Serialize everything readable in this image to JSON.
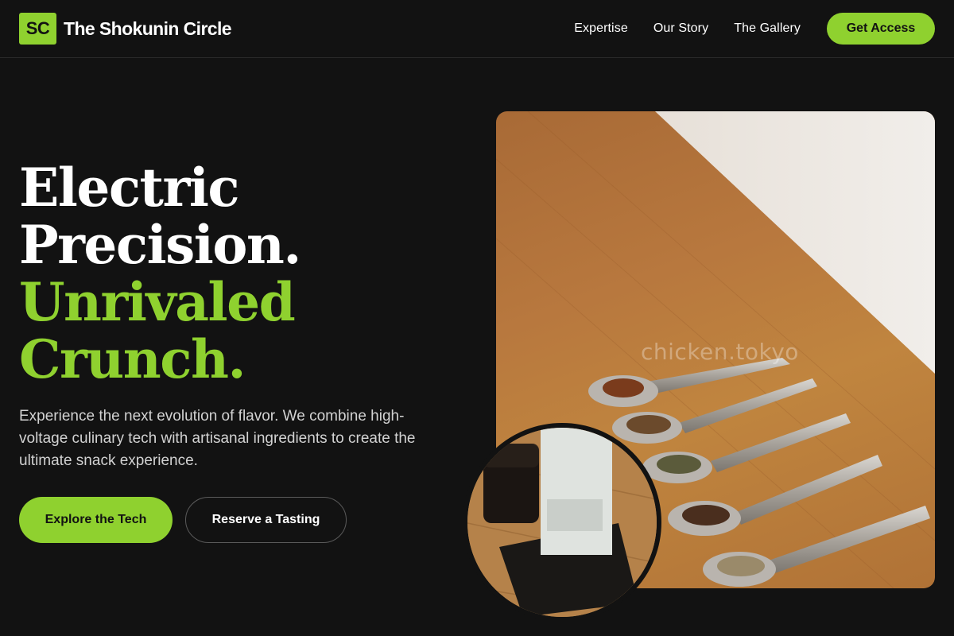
{
  "header": {
    "logo_text": "SC",
    "brand_name": "The Shokunin Circle",
    "nav": [
      "Expertise",
      "Our Story",
      "The Gallery"
    ],
    "cta_label": "Get Access"
  },
  "hero": {
    "title_lines": [
      "Electric",
      "Precision.",
      "Unrivaled",
      "Crunch."
    ],
    "description": "Experience the next evolution of flavor. We combine high-voltage culinary tech with artisanal ingredients to create the ultimate snack experience.",
    "primary_button": "Explore the Tech",
    "secondary_button": "Reserve a Tasting"
  },
  "images": {
    "main_image": "spoons-with-tea-leaves-on-wooden-table",
    "main_watermark": "chicken.tokyo",
    "inset_image": "coffee-bag-and-cold-brew-on-wood"
  },
  "colors": {
    "accent": "#8fd12f",
    "background": "#121212",
    "text": "#ffffff"
  }
}
